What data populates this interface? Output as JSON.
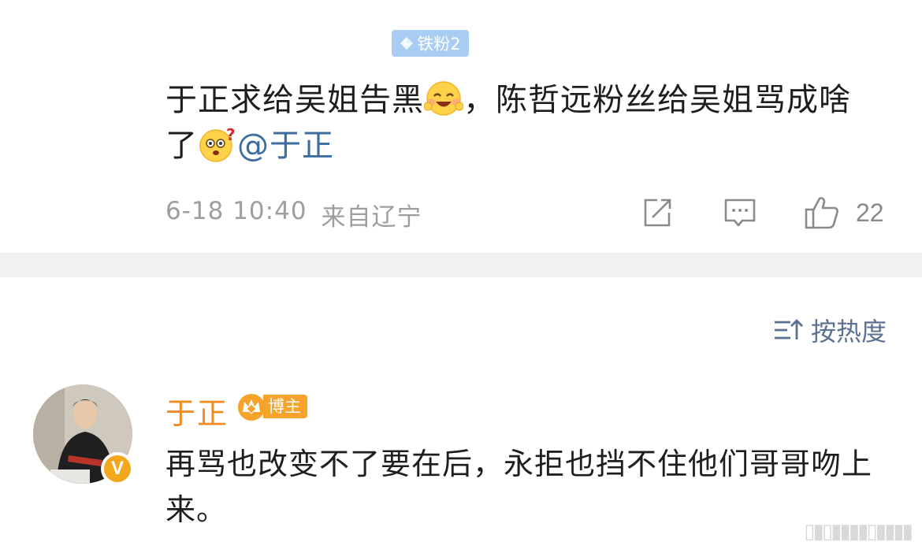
{
  "comment": {
    "fan_badge": "铁粉2",
    "text_part1": "于正求给吴姐告黑",
    "text_part2": "，陈哲远粉丝给吴姐骂成啥了",
    "mention": "@于正",
    "emoji_1": "laughing-emoji",
    "emoji_2": "confused-emoji",
    "date": "6-18 10:40",
    "location": "来自辽宁",
    "like_count": "22"
  },
  "sort": {
    "label": "按热度"
  },
  "reply": {
    "name": "于正",
    "badge": "博主",
    "text": "再骂也改变不了要在后，永拒也挡不住他们哥哥吻上来。"
  },
  "colors": {
    "name_orange": "#f08c21",
    "mention_blue": "#3d6c9e",
    "divider": "#f1f1f1",
    "meta_gray": "#9e9e9e",
    "sort_blue": "#5a7191"
  },
  "icons": [
    "diamond-icon",
    "share-icon",
    "comment-icon",
    "like-icon",
    "sort-icon",
    "crown-icon",
    "verified-v-icon"
  ]
}
